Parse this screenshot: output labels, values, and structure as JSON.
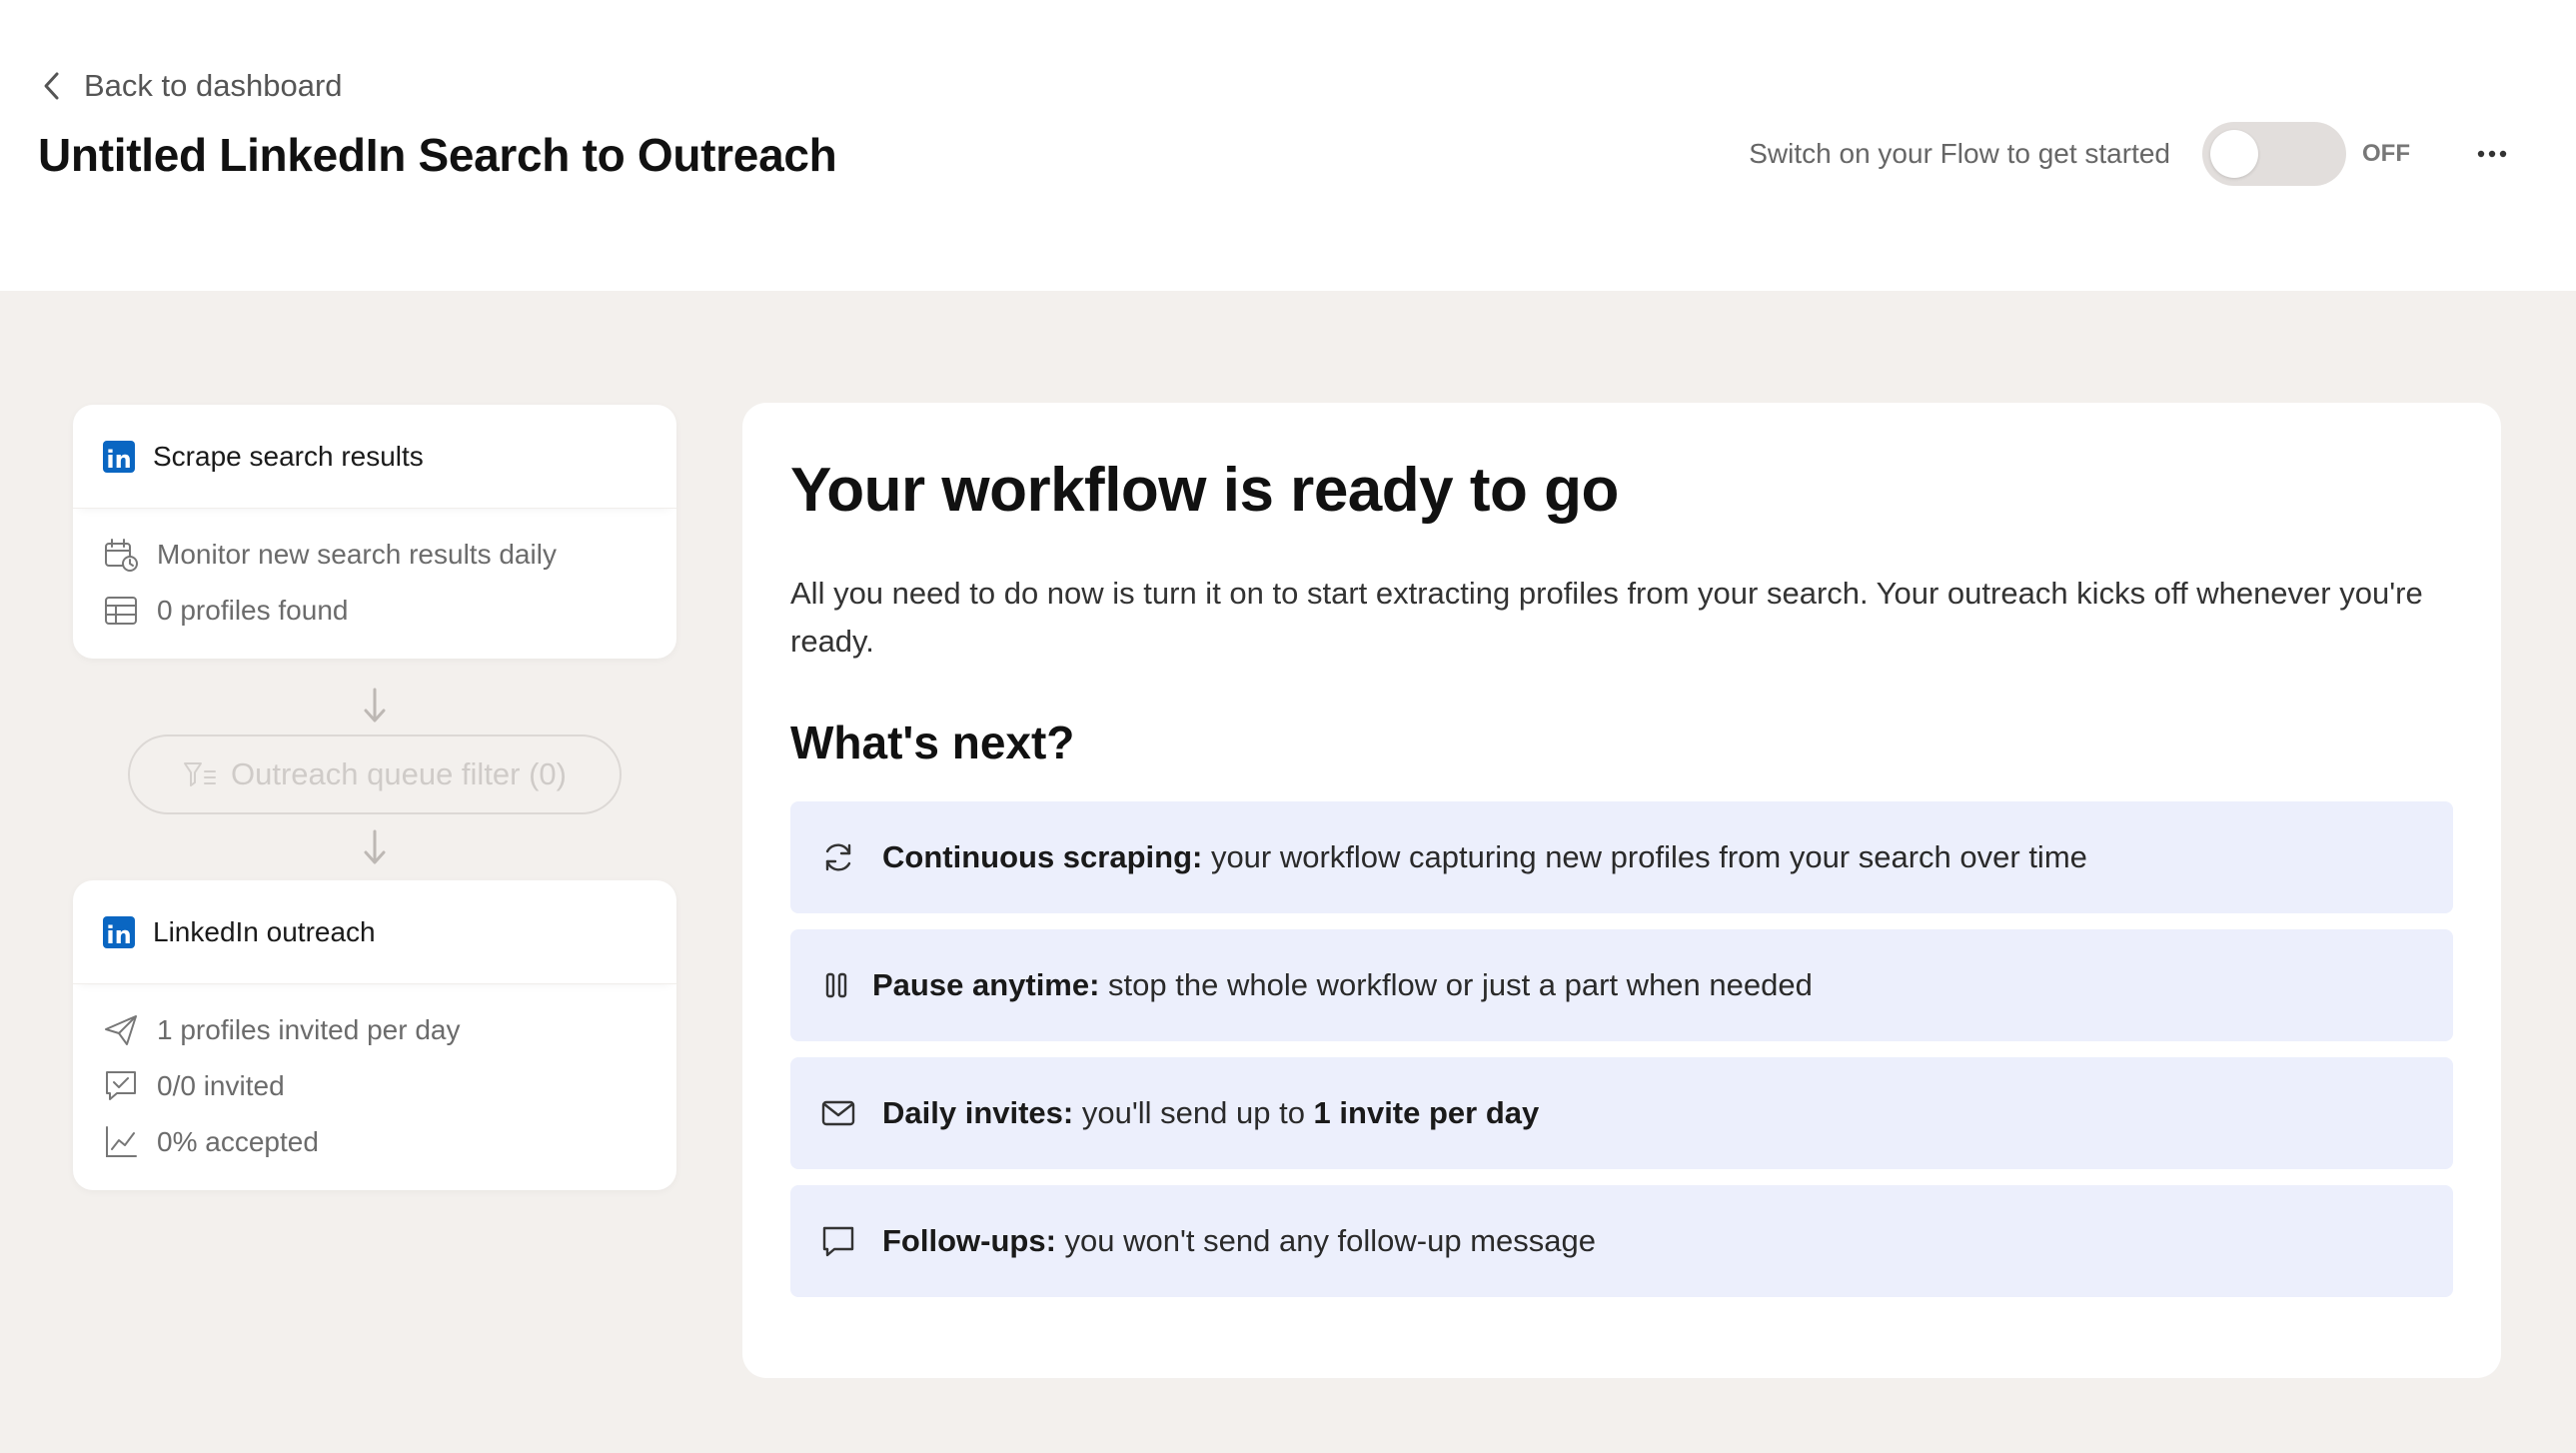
{
  "header": {
    "back_label": "Back to dashboard",
    "title": "Untitled LinkedIn Search to Outreach",
    "switch_hint": "Switch on your Flow to get started",
    "toggle_state": "OFF"
  },
  "flow": {
    "scrape_card": {
      "title": "Scrape search results",
      "rows": [
        "Monitor new search results daily",
        "0 profiles found"
      ]
    },
    "filter": {
      "label": "Outreach queue filter (0)"
    },
    "outreach_card": {
      "title": "LinkedIn outreach",
      "rows": [
        "1 profiles invited per day",
        "0/0 invited",
        "0% accepted"
      ]
    }
  },
  "panel": {
    "title": "Your workflow is ready to go",
    "description": "All you need to do now is turn it on to start extracting profiles from your search. Your outreach kicks off whenever you're ready.",
    "next_title": "What's next?",
    "items": [
      {
        "icon": "refresh-icon",
        "bold": "Continuous scraping:",
        "text": " your workflow capturing new profiles from your search over time"
      },
      {
        "icon": "pause-icon",
        "bold": "Pause anytime:",
        "text": " stop the whole workflow or just a part when needed"
      },
      {
        "icon": "envelope-icon",
        "bold": "Daily invites:",
        "text": " you'll send up to ",
        "bold2": "1 invite per day"
      },
      {
        "icon": "chat-bubble-icon",
        "bold": "Follow-ups:",
        "text": " you won't send any follow-up message"
      }
    ]
  },
  "colors": {
    "canvas_bg": "#f3f0ed",
    "info_bg": "#eceffc",
    "linkedin_blue": "#0a66c2",
    "toggle_off": "#e2dedc"
  }
}
